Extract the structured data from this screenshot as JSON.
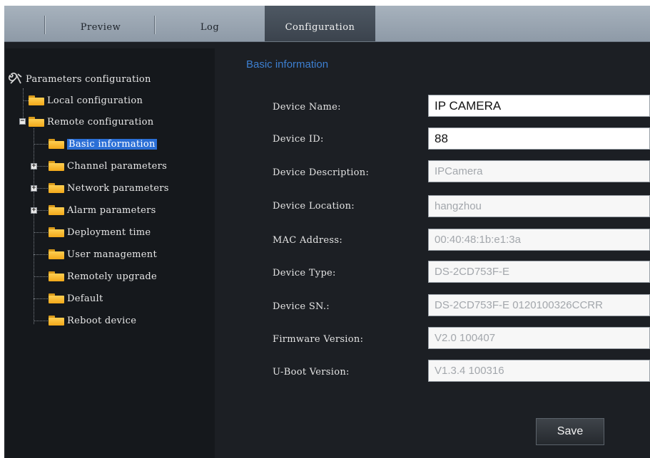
{
  "tabs": [
    {
      "label": "Preview"
    },
    {
      "label": "Log"
    },
    {
      "label": "Configuration",
      "active": true
    }
  ],
  "tree": {
    "root_label": "Parameters configuration",
    "local_label": "Local configuration",
    "remote_label": "Remote configuration",
    "remote_children": [
      {
        "label": "Basic information",
        "selected": true,
        "expandable": false
      },
      {
        "label": "Channel parameters",
        "expandable": true
      },
      {
        "label": "Network parameters",
        "expandable": true
      },
      {
        "label": "Alarm parameters",
        "expandable": true
      },
      {
        "label": "Deployment time",
        "expandable": false
      },
      {
        "label": "User management",
        "expandable": false
      },
      {
        "label": "Remotely upgrade",
        "expandable": false
      },
      {
        "label": "Default",
        "expandable": false
      },
      {
        "label": "Reboot device",
        "expandable": false
      }
    ]
  },
  "section_title": "Basic information",
  "fields": [
    {
      "label": "Device Name:",
      "value": "IP CAMERA",
      "editable": true
    },
    {
      "label": "Device ID:",
      "value": "88",
      "editable": true
    },
    {
      "label": "Device Description:",
      "value": "IPCamera",
      "editable": false
    },
    {
      "label": "Device Location:",
      "value": "hangzhou",
      "editable": false
    },
    {
      "label": "MAC Address:",
      "value": "00:40:48:1b:e1:3a",
      "editable": false
    },
    {
      "label": "Device Type:",
      "value": "DS-2CD753F-E",
      "editable": false
    },
    {
      "label": "Device SN.:",
      "value": "DS-2CD753F-E 0120100326CCRR",
      "editable": false
    },
    {
      "label": "Firmware Version:",
      "value": "V2.0  100407",
      "editable": false
    },
    {
      "label": "U-Boot Version:",
      "value": "V1.3.4  100316",
      "editable": false
    }
  ],
  "save_label": "Save",
  "colors": {
    "accent": "#3d7fd1",
    "selected": "#2b6fd6",
    "folder": "#f2a81a"
  }
}
